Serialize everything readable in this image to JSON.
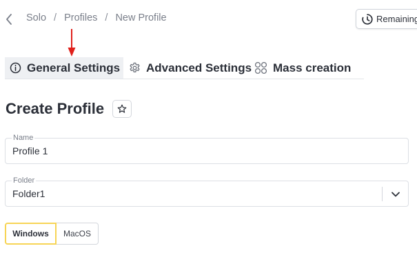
{
  "breadcrumb": {
    "items": [
      "Solo",
      "Profiles",
      "New Profile"
    ],
    "separator": "/"
  },
  "header": {
    "remaining_label": "Remaining"
  },
  "tabs": [
    {
      "label": "General Settings",
      "icon": "info-icon",
      "active": true
    },
    {
      "label": "Advanced Settings",
      "icon": "gear-icon",
      "active": false
    },
    {
      "label": "Mass creation",
      "icon": "grid-icon",
      "active": false
    }
  ],
  "page": {
    "title": "Create Profile",
    "favorite_icon": "star-icon"
  },
  "form": {
    "name": {
      "label": "Name",
      "value": "Profile 1"
    },
    "folder": {
      "label": "Folder",
      "value": "Folder1"
    }
  },
  "os": {
    "options": [
      "Windows",
      "MacOS"
    ],
    "selected": "Windows"
  },
  "colors": {
    "accent": "#f7d455",
    "annotation": "#e0201b",
    "text": "#2b2f38",
    "muted": "#7a7f8a"
  }
}
